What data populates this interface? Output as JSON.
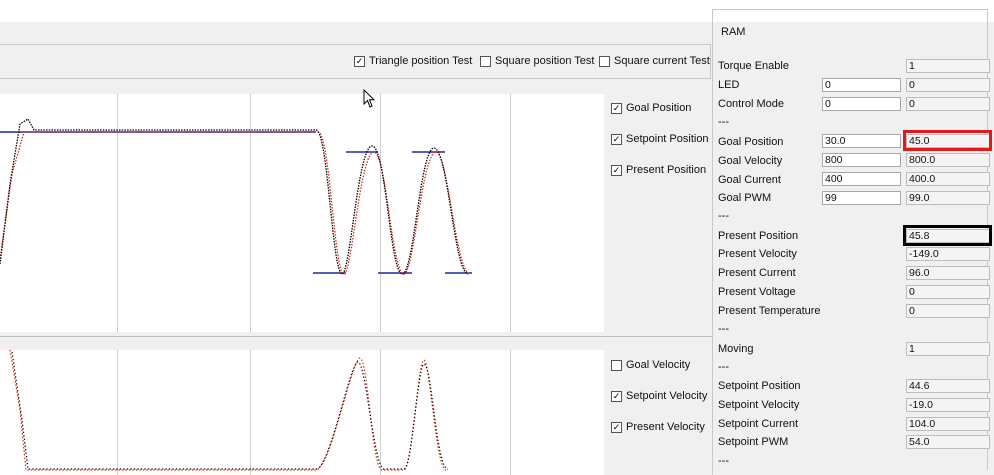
{
  "tests": {
    "triangle": {
      "label": "Triangle position Test",
      "checked": true
    },
    "square_position": {
      "label": "Square position Test",
      "checked": false
    },
    "square_current": {
      "label": "Square current Test",
      "checked": false
    }
  },
  "top_legend": {
    "goal_position": {
      "label": "Goal Position",
      "checked": true
    },
    "setpoint_position": {
      "label": "Setpoint Position",
      "checked": true
    },
    "present_position": {
      "label": "Present Position",
      "checked": true
    }
  },
  "bottom_legend": {
    "goal_velocity": {
      "label": "Goal Velocity",
      "checked": false
    },
    "setpoint_velocity": {
      "label": "Setpoint Velocity",
      "checked": true
    },
    "present_velocity": {
      "label": "Present Velocity",
      "checked": true
    }
  },
  "ram": {
    "title": "RAM",
    "separator": "---",
    "torque_enable": {
      "label": "Torque Enable",
      "value": "1"
    },
    "led": {
      "label": "LED",
      "input": "0",
      "value": "0"
    },
    "control_mode": {
      "label": "Control Mode",
      "input": "0",
      "value": "0"
    },
    "goal_position": {
      "label": "Goal Position",
      "input": "30.0",
      "value": "45.0"
    },
    "goal_velocity": {
      "label": "Goal Velocity",
      "input": "800",
      "value": "800.0"
    },
    "goal_current": {
      "label": "Goal Current",
      "input": "400",
      "value": "400.0"
    },
    "goal_pwm": {
      "label": "Goal PWM",
      "input": "99",
      "value": "99.0"
    },
    "present_position": {
      "label": "Present Position",
      "value": "45.8"
    },
    "present_velocity": {
      "label": "Present Velocity",
      "value": "-149.0"
    },
    "present_current": {
      "label": "Present Current",
      "value": "96.0"
    },
    "present_voltage": {
      "label": "Present Voltage",
      "value": "0"
    },
    "present_temperature": {
      "label": "Present Temperature",
      "value": "0"
    },
    "moving": {
      "label": "Moving",
      "value": "1"
    },
    "setpoint_position": {
      "label": "Setpoint Position",
      "value": "44.6"
    },
    "setpoint_velocity": {
      "label": "Setpoint Velocity",
      "value": "-19.0"
    },
    "setpoint_current": {
      "label": "Setpoint Current",
      "value": "104.0"
    },
    "setpoint_pwm": {
      "label": "Setpoint PWM",
      "value": "54.0"
    }
  },
  "colors": {
    "goal": "#1f2aa3",
    "setpoint": "#e0261b",
    "present": "#000000",
    "highlight_red": "#e31a1c",
    "highlight_black": "#000000"
  }
}
